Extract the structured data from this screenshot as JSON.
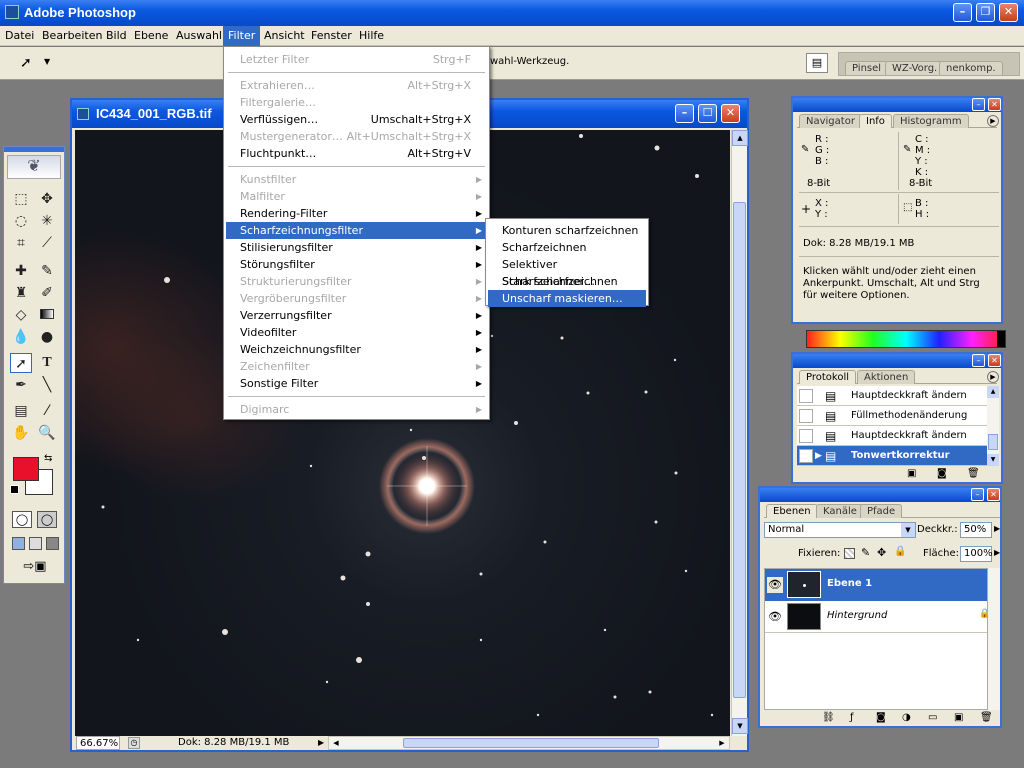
{
  "app": {
    "title": "Adobe Photoshop"
  },
  "menubar": {
    "items": [
      "Datei",
      "Bearbeiten",
      "Bild",
      "Ebene",
      "Auswahl",
      "Filter",
      "Ansicht",
      "Fenster",
      "Hilfe"
    ]
  },
  "options": {
    "hint": "wahl-Werkzeug.",
    "tabs": [
      "Pinsel",
      "WZ-Vorg.",
      "nenkomp."
    ]
  },
  "filter_menu": {
    "items": [
      {
        "label": "Letzter Filter",
        "shortcut": "Strg+F",
        "disabled": true
      },
      {
        "sep": true
      },
      {
        "label": "Extrahieren…",
        "shortcut": "Alt+Strg+X",
        "disabled": true
      },
      {
        "label": "Filtergalerie…",
        "disabled": true
      },
      {
        "label": "Verflüssigen…",
        "shortcut": "Umschalt+Strg+X"
      },
      {
        "label": "Mustergenerator…",
        "shortcut": "Alt+Umschalt+Strg+X",
        "disabled": true
      },
      {
        "label": "Fluchtpunkt…",
        "shortcut": "Alt+Strg+V"
      },
      {
        "sep": true
      },
      {
        "label": "Kunstfilter",
        "sub": true,
        "disabled": true
      },
      {
        "label": "Malfilter",
        "sub": true,
        "disabled": true
      },
      {
        "label": "Rendering-Filter",
        "sub": true
      },
      {
        "label": "Scharfzeichnungsfilter",
        "sub": true,
        "highlighted": true
      },
      {
        "label": "Stilisierungsfilter",
        "sub": true
      },
      {
        "label": "Störungsfilter",
        "sub": true
      },
      {
        "label": "Strukturierungsfilter",
        "sub": true,
        "disabled": true
      },
      {
        "label": "Vergröberungsfilter",
        "sub": true,
        "disabled": true
      },
      {
        "label": "Verzerrungsfilter",
        "sub": true
      },
      {
        "label": "Videofilter",
        "sub": true
      },
      {
        "label": "Weichzeichnungsfilter",
        "sub": true
      },
      {
        "label": "Zeichenfilter",
        "sub": true,
        "disabled": true
      },
      {
        "label": "Sonstige Filter",
        "sub": true
      },
      {
        "sep": true
      },
      {
        "label": "Digimarc",
        "sub": true,
        "disabled": true
      }
    ]
  },
  "sharpen_submenu": {
    "items": [
      "Konturen scharfzeichnen",
      "Scharfzeichnen",
      "Selektiver Scharfzeichner…",
      "Stark scharfzeichnen",
      "Unscharf maskieren…"
    ],
    "highlighted_index": 4
  },
  "document": {
    "title": "IC434_001_RGB.tif",
    "zoom": "66.67%",
    "doc_size": "Dok: 8.28 MB/19.1 MB"
  },
  "info_panel": {
    "tabs": [
      "Navigator",
      "Info",
      "Histogramm"
    ],
    "active_tab": "Info",
    "rgb": [
      "R :",
      "G :",
      "B :"
    ],
    "cmyk": [
      "C :",
      "M :",
      "Y :",
      "K :"
    ],
    "bit_left": "8-Bit",
    "bit_right": "8-Bit",
    "xy": [
      "X :",
      "Y :"
    ],
    "bh": [
      "B :",
      "H :"
    ],
    "doc": "Dok: 8.28 MB/19.1 MB",
    "hint": "Klicken wählt und/oder zieht einen Ankerpunkt. Umschalt, Alt und Strg für weitere Optionen."
  },
  "history_panel": {
    "tabs": [
      "Protokoll",
      "Aktionen"
    ],
    "active_tab": "Protokoll",
    "items": [
      "Hauptdeckkraft ändern",
      "Füllmethodenänderung",
      "Hauptdeckkraft ändern",
      "Tonwertkorrektur"
    ],
    "active_index": 3
  },
  "layers_panel": {
    "tabs": [
      "Ebenen",
      "Kanäle",
      "Pfade"
    ],
    "active_tab": "Ebenen",
    "blend_mode": "Normal",
    "opacity_label": "Deckkr.:",
    "opacity": "50%",
    "lock_label": "Fixieren:",
    "fill_label": "Fläche:",
    "fill": "100%",
    "layers": [
      {
        "name": "Ebene 1",
        "selected": true
      },
      {
        "name": "Hintergrund",
        "locked": true
      }
    ]
  },
  "colors": {
    "foreground": "#e8102a",
    "background": "#ffffff",
    "accent": "#316ac5",
    "titlebar": "#0a58e0"
  }
}
